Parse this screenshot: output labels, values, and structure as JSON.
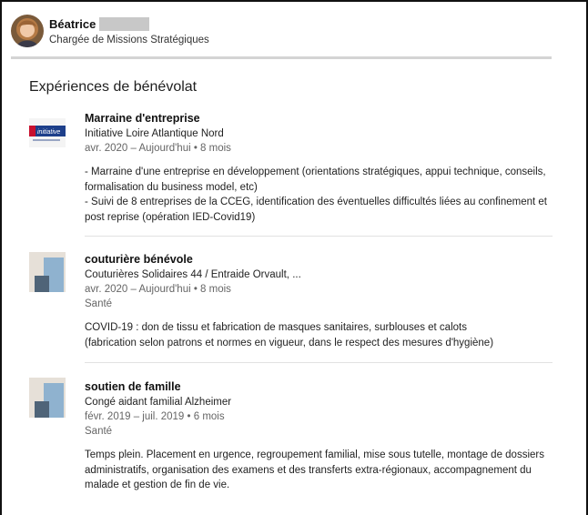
{
  "profile": {
    "first_name": "Béatrice",
    "headline": "Chargée de Missions Stratégiques"
  },
  "section": {
    "title": "Expériences de bénévolat"
  },
  "entries": [
    {
      "role": "Marraine d'entreprise",
      "org": "Initiative Loire Atlantique Nord",
      "dates": "avr. 2020 – Aujourd'hui  • 8 mois",
      "logo_text": "initiative",
      "desc": [
        "- Marraine d'une entreprise en développement (orientations stratégiques, appui technique, conseils, formalisation du business model, etc)",
        "- Suivi de 8 entreprises de la CCEG, identification des éventuelles difficultés liées au confinement et post reprise (opération IED-Covid19)"
      ]
    },
    {
      "role": "couturière bénévole",
      "org": "Couturières Solidaires 44 / Entraide Orvault, ...",
      "dates": "avr. 2020 – Aujourd'hui  • 8 mois",
      "cause": "Santé",
      "desc": [
        "COVID-19 : don de tissu et fabrication de masques sanitaires, surblouses et calots",
        "(fabrication selon patrons et normes en vigueur, dans le respect des mesures d'hygiène)"
      ]
    },
    {
      "role": "soutien de famille",
      "org": "Congé aidant familial Alzheimer",
      "dates": "févr. 2019 – juil. 2019  • 6 mois",
      "cause": "Santé",
      "desc": [
        "Temps plein. Placement en urgence, regroupement familial, mise sous tutelle, montage de dossiers administratifs, organisation des examens et des transferts extra-régionaux, accompagnement du malade et gestion de fin de vie."
      ]
    }
  ],
  "colors": {
    "generic_logo_light": "#e6e0d8",
    "generic_logo_blue": "#8fb2cf",
    "generic_logo_dark": "#4f6478",
    "initiative_red": "#c8102e",
    "initiative_blue": "#1d3f8a"
  }
}
